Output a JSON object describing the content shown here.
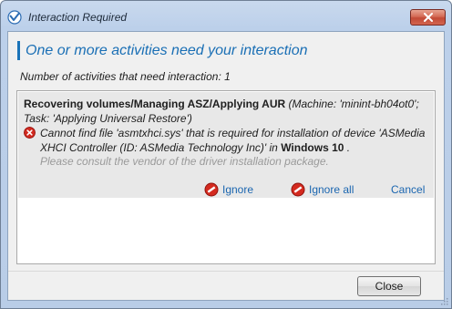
{
  "window": {
    "title": "Interaction Required"
  },
  "header": {
    "headline": "One or more activities need your interaction",
    "count_text": "Number of activities that need interaction: 1"
  },
  "activity": {
    "title_bold": "Recovering volumes/Managing ASZ/Applying AUR",
    "title_meta": " (Machine: 'minint-bh04ot0'; Task: 'Applying Universal Restore')",
    "error_prefix": "Cannot find file 'asmtxhci.sys' that is required for installation of device 'ASMedia XHCI Controller (ID: ASMedia Technology Inc)' in ",
    "error_os": "Windows 10",
    "error_suffix": " .",
    "hint": "Please consult the vendor of the driver installation package.",
    "actions": {
      "ignore": "Ignore",
      "ignore_all": "Ignore all",
      "cancel": "Cancel"
    }
  },
  "footer": {
    "close_label": "Close"
  },
  "colors": {
    "accent": "#1a6fb5",
    "error": "#c8231a",
    "link": "#1b66b0",
    "hint": "#9a9a9a"
  },
  "icons": {
    "app": "app-logo-icon",
    "window_close": "close-icon",
    "error": "error-icon",
    "ignore": "no-entry-icon",
    "ignore_all": "no-entry-icon"
  }
}
